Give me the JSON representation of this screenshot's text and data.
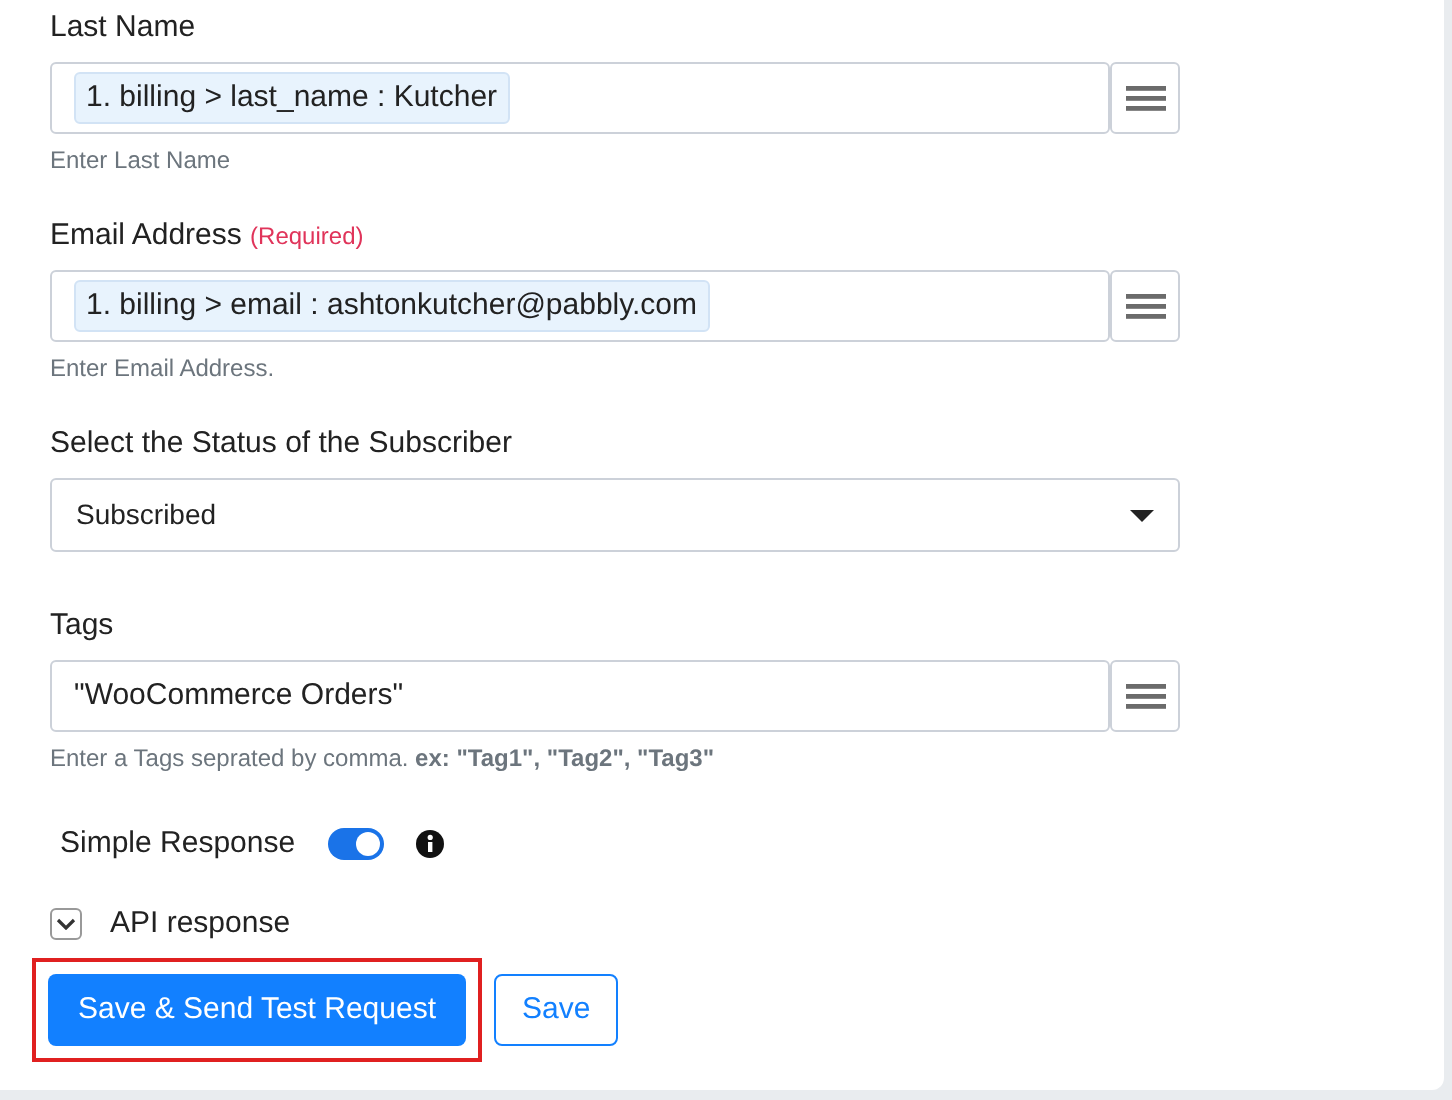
{
  "fields": [
    {
      "kind": "mapped",
      "label": "Last Name",
      "value": "1. billing > last_name : Kutcher",
      "hint": "Enter Last Name"
    },
    {
      "kind": "mapped",
      "label": "Email Address",
      "required": "(Required)",
      "value": "1. billing > email : ashtonkutcher@pabbly.com",
      "hint": "Enter Email Address."
    },
    {
      "kind": "select",
      "label": "Select the Status of the Subscriber",
      "value": "Subscribed"
    },
    {
      "kind": "text",
      "label": "Tags",
      "value": "\"WooCommerce Orders\"",
      "hint": "Enter a Tags seprated by comma. **ex: \"Tag1\", \"Tag2\", \"Tag3\"**"
    }
  ],
  "simple_response": {
    "label": "Simple Response",
    "on": true
  },
  "api_response": {
    "label": "API response",
    "expanded": false
  },
  "buttons": [
    {
      "kind": "primary",
      "label": "Save & Send Test Request",
      "highlighted": true
    },
    {
      "kind": "outline",
      "label": "Save",
      "highlighted": false
    }
  ]
}
